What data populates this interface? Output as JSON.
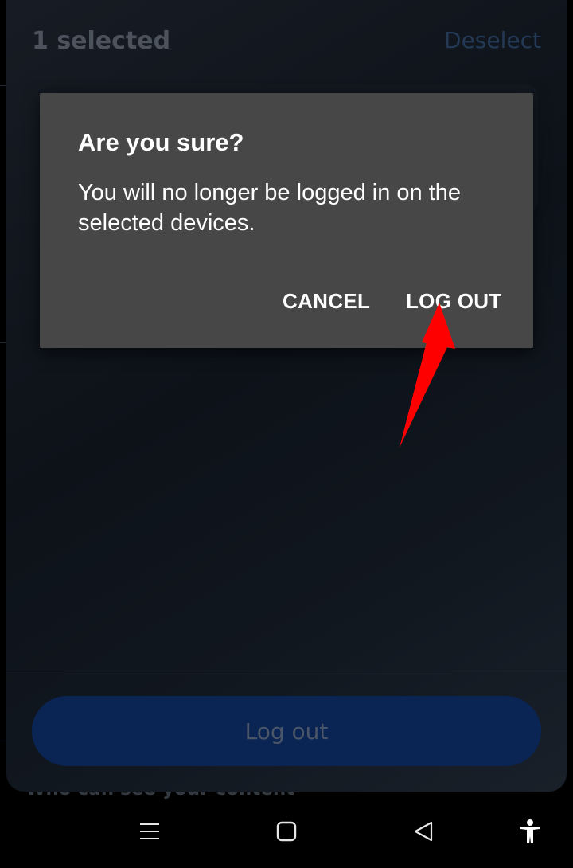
{
  "background": {
    "peek_text": "Who can see your content"
  },
  "sheet": {
    "title": "1 selected",
    "deselect_label": "Deselect",
    "logout_button_label": "Log out"
  },
  "dialog": {
    "title": "Are you sure?",
    "message": "You will no longer be logged in on the selected devices.",
    "cancel_label": "CANCEL",
    "logout_label": "LOG OUT"
  },
  "navbar": {
    "icons": [
      "menu-icon",
      "home-icon",
      "back-icon",
      "accessibility-icon"
    ]
  },
  "colors": {
    "dialog_bg": "#474747",
    "primary_button": "#0a2453",
    "annotation_arrow": "#ff0000"
  }
}
